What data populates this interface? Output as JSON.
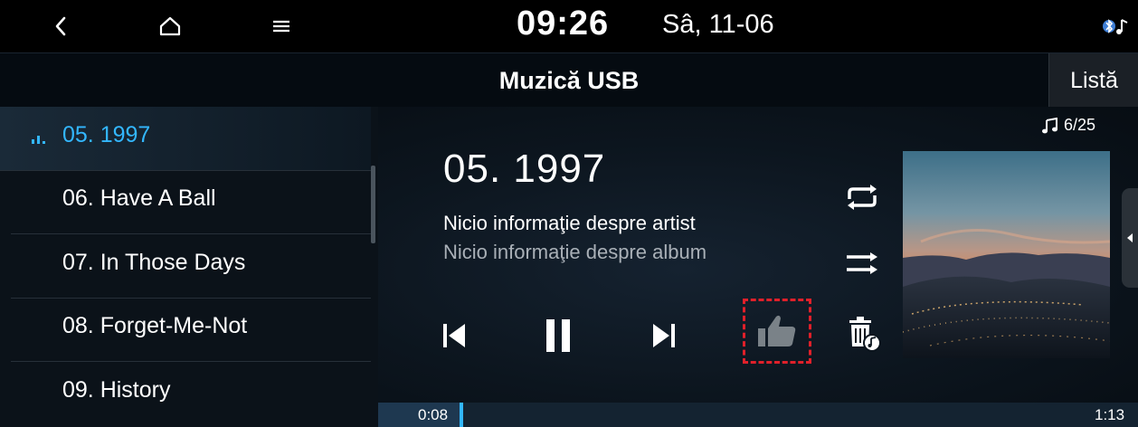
{
  "status": {
    "time": "09:26",
    "date": "Sâ, 11-06"
  },
  "header": {
    "title": "Muzică USB",
    "list_label": "Listă"
  },
  "playlist": {
    "items": [
      {
        "label": "05. 1997",
        "active": true
      },
      {
        "label": "06. Have A Ball",
        "active": false
      },
      {
        "label": "07. In Those Days",
        "active": false
      },
      {
        "label": "08. Forget-Me-Not",
        "active": false
      },
      {
        "label": "09. History",
        "active": false
      }
    ]
  },
  "player": {
    "track_counter": "6/25",
    "title": "05. 1997",
    "artist": "Nicio informaţie despre artist",
    "album": "Nicio informaţie despre album",
    "elapsed": "0:08",
    "total": "1:13",
    "progress_fraction": 0.11
  },
  "colors": {
    "accent": "#33b7ff",
    "highlight_dashed": "#e0202a"
  },
  "icons": [
    "back-icon",
    "home-icon",
    "menu-icon",
    "bluetooth-audio-icon",
    "music-note-icon",
    "repeat-icon",
    "shuffle-icon",
    "previous-track-icon",
    "pause-icon",
    "next-track-icon",
    "like-icon",
    "delete-music-icon"
  ]
}
